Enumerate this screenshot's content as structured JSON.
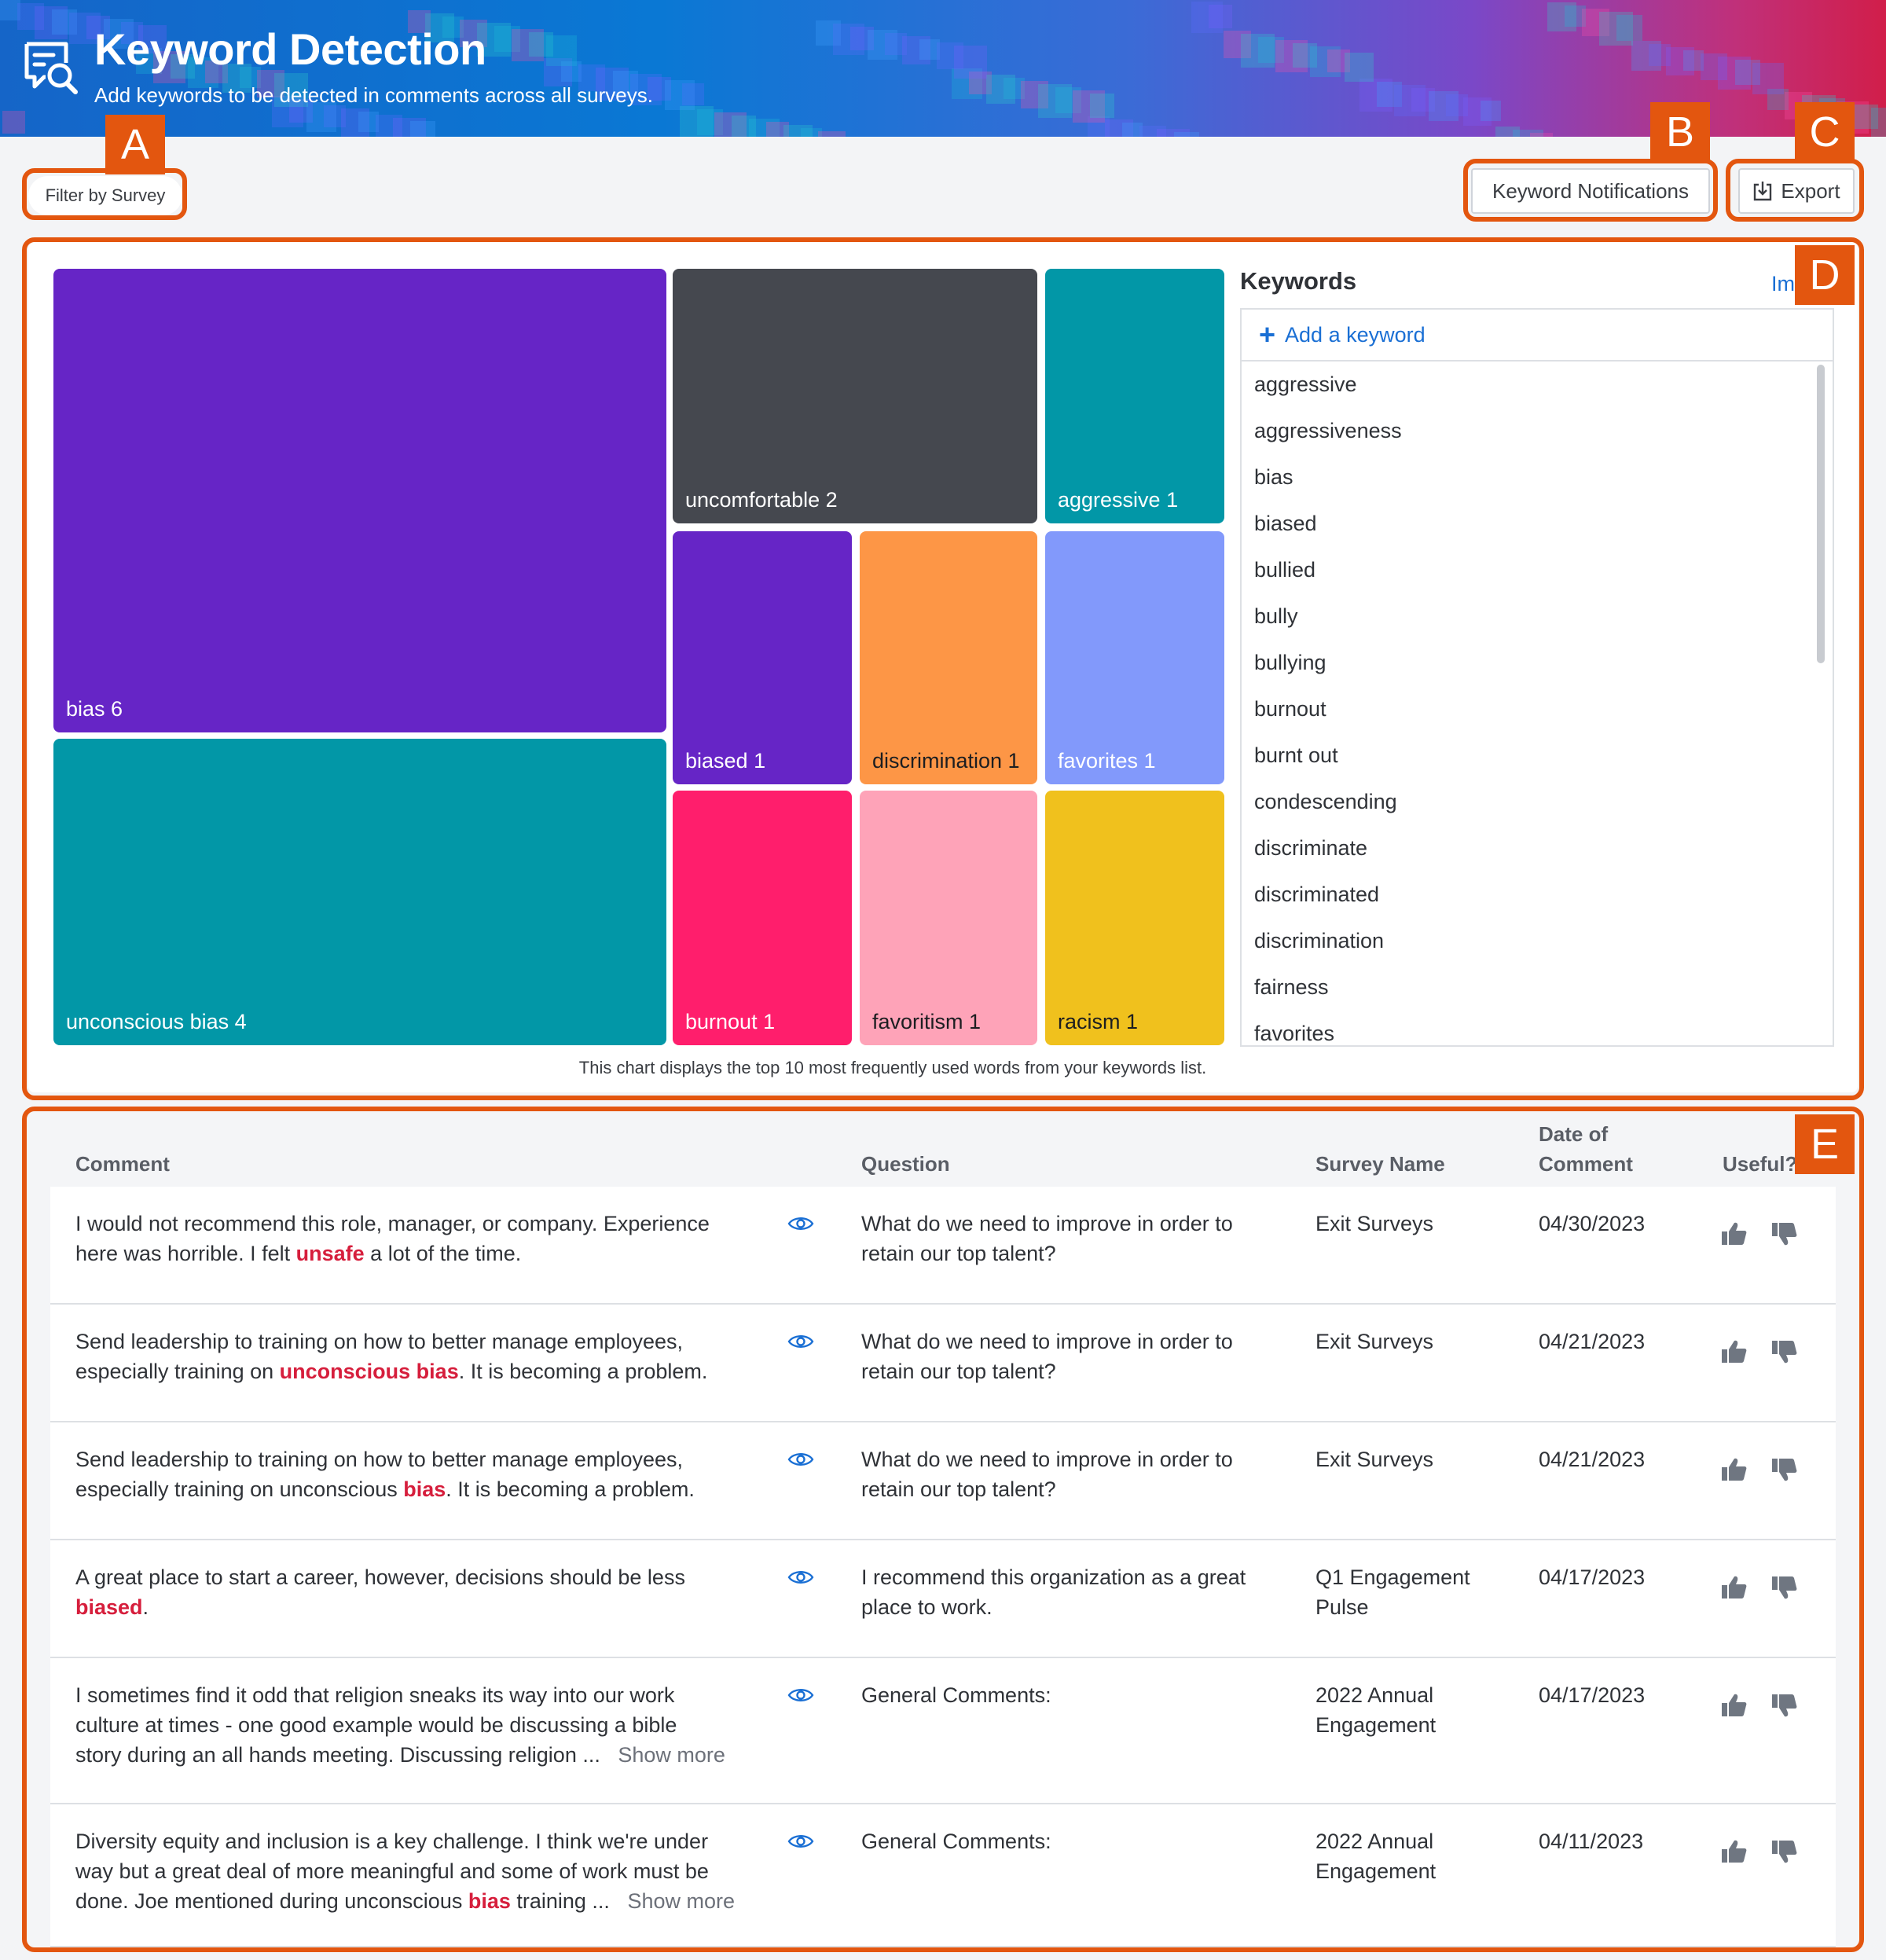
{
  "header": {
    "title": "Keyword Detection",
    "subtitle": "Add keywords to be detected in comments across all surveys."
  },
  "toolbar": {
    "filter_label": "Filter by Survey",
    "notifications_label": "Keyword Notifications",
    "export_label": "Export"
  },
  "callouts": [
    "A",
    "B",
    "C",
    "D",
    "E"
  ],
  "chart_data": {
    "type": "treemap",
    "caption": "This chart displays the top 10 most frequently used words from your keywords list.",
    "items": [
      {
        "label": "bias 6",
        "keyword": "bias",
        "value": 6,
        "color": "#6625c6"
      },
      {
        "label": "unconscious bias 4",
        "keyword": "unconscious bias",
        "value": 4,
        "color": "#0297a7"
      },
      {
        "label": "uncomfortable 2",
        "keyword": "uncomfortable",
        "value": 2,
        "color": "#45484f"
      },
      {
        "label": "aggressive 1",
        "keyword": "aggressive",
        "value": 1,
        "color": "#0297a7"
      },
      {
        "label": "biased 1",
        "keyword": "biased",
        "value": 1,
        "color": "#6625c6"
      },
      {
        "label": "discrimination 1",
        "keyword": "discrimination",
        "value": 1,
        "color": "#fd9646"
      },
      {
        "label": "favorites 1",
        "keyword": "favorites",
        "value": 1,
        "color": "#8299fb"
      },
      {
        "label": "burnout 1",
        "keyword": "burnout",
        "value": 1,
        "color": "#ff1e6c"
      },
      {
        "label": "favoritism 1",
        "keyword": "favoritism",
        "value": 1,
        "color": "#fea3b8"
      },
      {
        "label": "racism 1",
        "keyword": "racism",
        "value": 1,
        "color": "#f0c11d"
      }
    ]
  },
  "keywords": {
    "title": "Keywords",
    "import_label": "Im",
    "add_label": "Add a keyword",
    "items": [
      "aggressive",
      "aggressiveness",
      "bias",
      "biased",
      "bullied",
      "bully",
      "bullying",
      "burnout",
      "burnt out",
      "condescending",
      "discriminate",
      "discriminated",
      "discrimination",
      "fairness",
      "favorites"
    ]
  },
  "table": {
    "headers": {
      "comment": "Comment",
      "question": "Question",
      "survey": "Survey Name",
      "date_line1": "Date of",
      "date_line2": "Comment",
      "useful": "Useful?"
    },
    "rows": [
      {
        "comment_lines": [
          [
            "I would not recommend this role, manager, or company. Experience"
          ],
          [
            "here was horrible. I felt ",
            "unsafe",
            " a lot of the time."
          ]
        ],
        "question_lines": [
          "What do we need to improve in order to",
          "retain our top talent?"
        ],
        "survey_lines": [
          "Exit Surveys"
        ],
        "date": "04/30/2023"
      },
      {
        "comment_lines": [
          [
            "Send leadership to training on how to better manage employees,"
          ],
          [
            "especially training on ",
            "unconscious bias",
            ". It is becoming a problem."
          ]
        ],
        "question_lines": [
          "What do we need to improve in order to",
          "retain our top talent?"
        ],
        "survey_lines": [
          "Exit Surveys"
        ],
        "date": "04/21/2023"
      },
      {
        "comment_lines": [
          [
            "Send leadership to training on how to better manage employees,"
          ],
          [
            "especially training on unconscious ",
            "bias",
            ". It is becoming a problem."
          ]
        ],
        "question_lines": [
          "What do we need to improve in order to",
          "retain our top talent?"
        ],
        "survey_lines": [
          "Exit Surveys"
        ],
        "date": "04/21/2023"
      },
      {
        "comment_lines": [
          [
            "A great place to start a career, however, decisions should be less"
          ],
          [
            "",
            "biased",
            "."
          ]
        ],
        "question_lines": [
          "I recommend this organization as a great",
          "place to work."
        ],
        "survey_lines": [
          "Q1 Engagement",
          "Pulse"
        ],
        "date": "04/17/2023"
      },
      {
        "comment_lines": [
          [
            "I sometimes find it odd that religion sneaks its way into our work"
          ],
          [
            "culture at times - one good example would be discussing a bible"
          ],
          [
            "story during an all hands meeting. Discussing religion ..."
          ]
        ],
        "show_more": "Show more",
        "question_lines": [
          "General Comments:"
        ],
        "survey_lines": [
          "2022 Annual",
          "Engagement"
        ],
        "date": "04/17/2023"
      },
      {
        "comment_lines": [
          [
            "Diversity equity and inclusion is a key challenge. I think we're under"
          ],
          [
            "way but a great deal of more meaningful and some of work must be"
          ],
          [
            "done. Joe mentioned during unconscious ",
            "bias",
            " training ..."
          ]
        ],
        "show_more": "Show more",
        "question_lines": [
          "General Comments:"
        ],
        "survey_lines": [
          "2022 Annual",
          "Engagement"
        ],
        "date": "04/11/2023"
      }
    ]
  },
  "colors": {
    "accent": "#1a6fd4",
    "highlight": "#d61e3c",
    "callout": "#e3560f"
  }
}
